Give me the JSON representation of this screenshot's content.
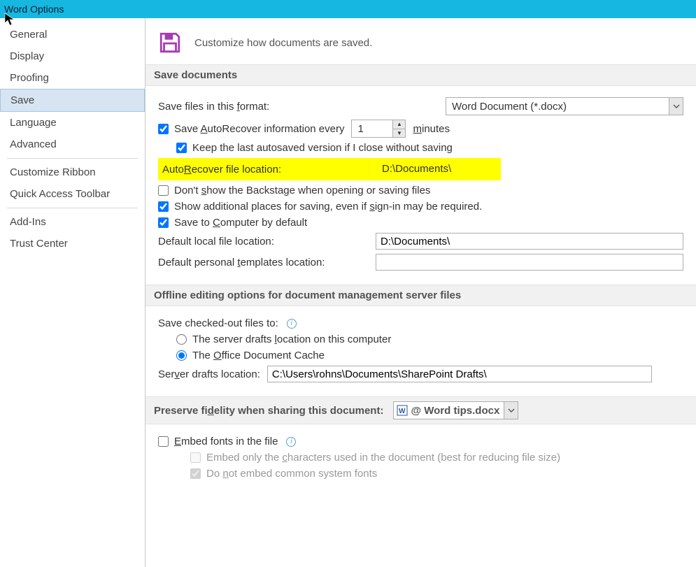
{
  "window": {
    "title": "Word Options"
  },
  "sidebar": {
    "groups": [
      [
        "General",
        "Display",
        "Proofing",
        "Save",
        "Language",
        "Advanced"
      ],
      [
        "Customize Ribbon",
        "Quick Access Toolbar"
      ],
      [
        "Add-Ins",
        "Trust Center"
      ]
    ],
    "selected": "Save"
  },
  "header": {
    "subtitle": "Customize how documents are saved."
  },
  "save_documents": {
    "heading": "Save documents",
    "format_label": "Save files in this format:",
    "format_value": "Word Document (*.docx)",
    "autorecover_label_pre": "Save AutoRecover information every",
    "autorecover_minutes": "1",
    "autorecover_label_post": "minutes",
    "autorecover_checked": true,
    "keep_last_label": "Keep the last autosaved version if I close without saving",
    "keep_last_checked": true,
    "autorecover_location_label": "AutoRecover file location:",
    "autorecover_location_value": "D:\\Documents\\",
    "dont_show_backstage_label": "Don't show the Backstage when opening or saving files",
    "dont_show_backstage_checked": false,
    "show_additional_label": "Show additional places for saving, even if sign-in may be required.",
    "show_additional_checked": true,
    "save_to_computer_label": "Save to Computer by default",
    "save_to_computer_checked": true,
    "default_local_label": "Default local file location:",
    "default_local_value": "D:\\Documents\\",
    "default_templates_label": "Default personal templates location:",
    "default_templates_value": ""
  },
  "offline": {
    "heading": "Offline editing options for document management server files",
    "save_checked_out_label": "Save checked-out files to:",
    "opt_server_drafts": "The server drafts location on this computer",
    "opt_office_cache": "The Office Document Cache",
    "selected": "cache",
    "server_drafts_label": "Server drafts location:",
    "server_drafts_value": "C:\\Users\\rohns\\Documents\\SharePoint Drafts\\"
  },
  "fidelity": {
    "heading": "Preserve fidelity when sharing this document:",
    "doc_name": "@ Word tips.docx",
    "embed_fonts_label": "Embed fonts in the file",
    "embed_fonts_checked": false,
    "embed_only_used_label": "Embed only the characters used in the document (best for reducing file size)",
    "embed_only_used_checked": false,
    "do_not_embed_label": "Do not embed common system fonts",
    "do_not_embed_checked": true
  }
}
